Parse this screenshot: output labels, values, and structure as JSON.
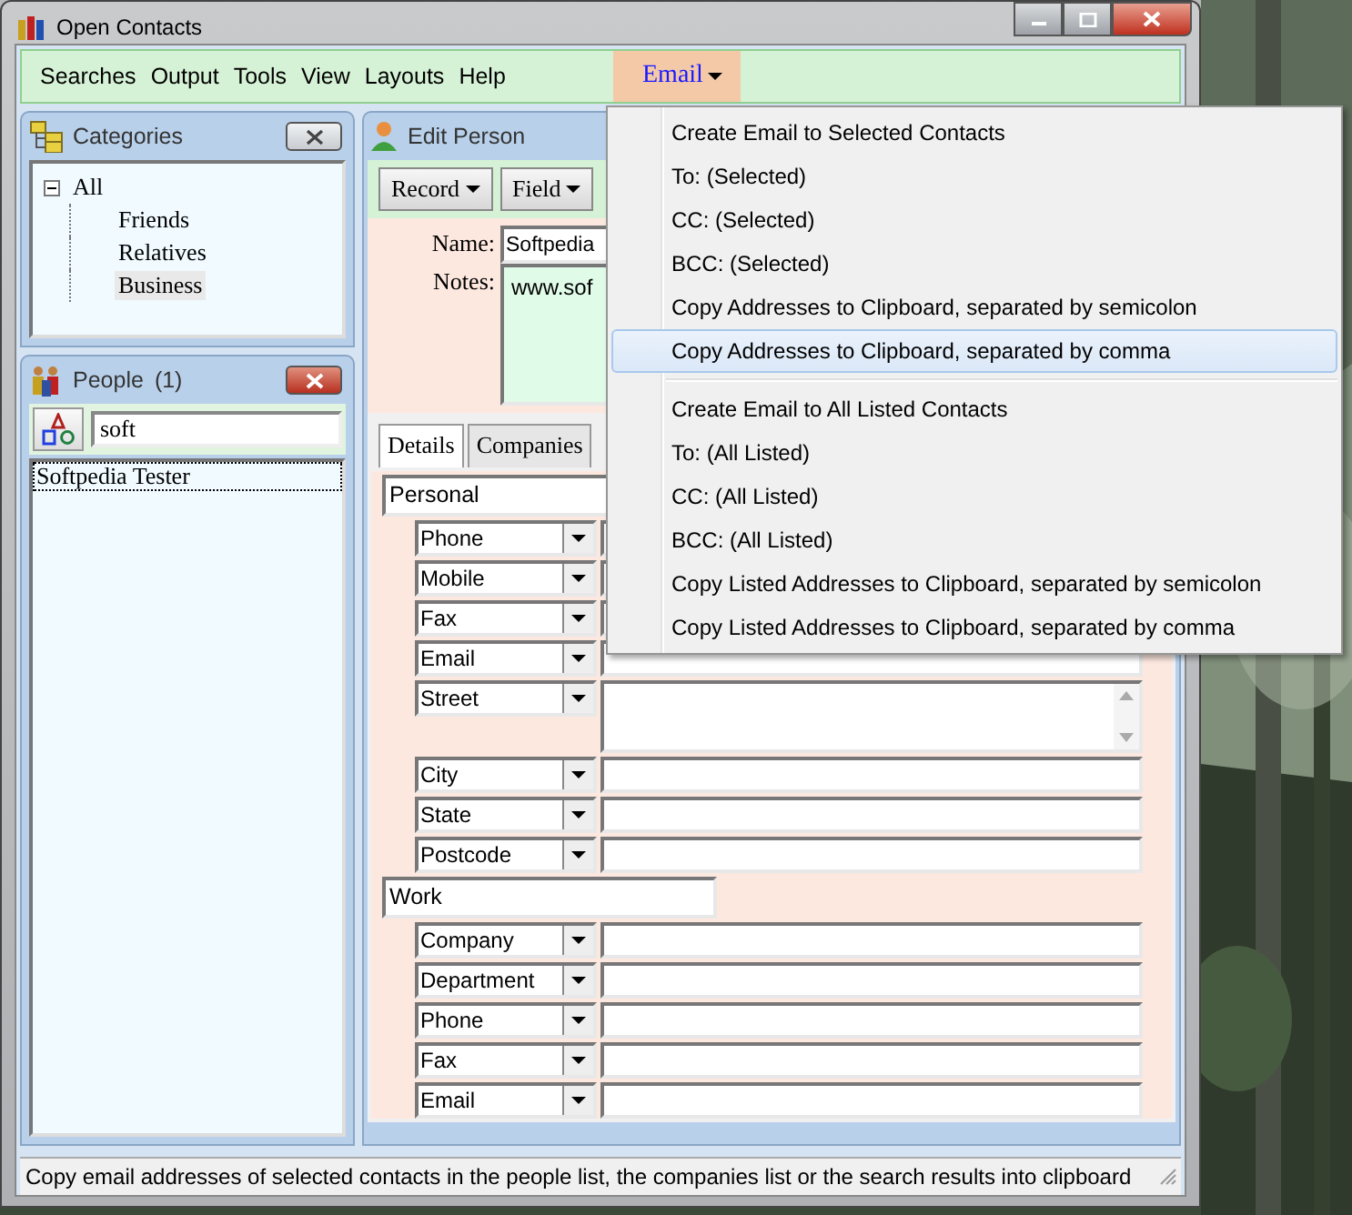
{
  "window": {
    "title": "Open Contacts"
  },
  "menu": [
    {
      "label": "Searches",
      "selected": false
    },
    {
      "label": "Output",
      "selected": false
    },
    {
      "label": "Tools",
      "selected": false
    },
    {
      "label": "View",
      "selected": false
    },
    {
      "label": "Layouts",
      "selected": false
    },
    {
      "label": "Help",
      "selected": false
    },
    {
      "label": "Email",
      "selected": true,
      "kind": "dropdown"
    }
  ],
  "email_menu": [
    [
      {
        "label": "Create Email to Selected Contacts",
        "selected": false
      },
      {
        "label": "To: (Selected)",
        "selected": false
      },
      {
        "label": "CC: (Selected)",
        "selected": false
      },
      {
        "label": "BCC: (Selected)",
        "selected": false
      },
      {
        "label": "Copy Addresses to Clipboard, separated by semicolon",
        "selected": false
      },
      {
        "label": "Copy Addresses to Clipboard, separated by comma",
        "selected": true
      }
    ],
    [
      {
        "label": "Create Email to All Listed Contacts",
        "selected": false
      },
      {
        "label": "To: (All Listed)",
        "selected": false
      },
      {
        "label": "CC: (All Listed)",
        "selected": false
      },
      {
        "label": "BCC: (All Listed)",
        "selected": false
      },
      {
        "label": "Copy Listed Addresses to Clipboard, separated by semicolon",
        "selected": false
      },
      {
        "label": "Copy Listed Addresses to Clipboard, separated by comma",
        "selected": false
      }
    ]
  ],
  "categories": {
    "title": "Categories",
    "tree": {
      "label": "All",
      "expanded": true,
      "children": [
        {
          "label": "Friends",
          "selected": false
        },
        {
          "label": "Relatives",
          "selected": false
        },
        {
          "label": "Business",
          "selected": true
        }
      ]
    }
  },
  "people": {
    "title": "People",
    "count": "(1)",
    "search": "soft",
    "results": [
      {
        "name": "Softpedia Tester",
        "selected": true
      }
    ]
  },
  "edit_person": {
    "title": "Edit Person",
    "toolbar": [
      "Record",
      "Field"
    ],
    "name_label": "Name:",
    "name": "Softpedia",
    "notes_label": "Notes:",
    "notes": "www.sof",
    "tabs": [
      {
        "label": "Details",
        "selected": true
      },
      {
        "label": "Companies",
        "selected": false
      }
    ],
    "groups": [
      {
        "title": "Personal",
        "fields": [
          {
            "label": "Phone",
            "kind": "line"
          },
          {
            "label": "Mobile",
            "kind": "line"
          },
          {
            "label": "Fax",
            "kind": "line"
          },
          {
            "label": "Email",
            "kind": "line"
          },
          {
            "label": "Street",
            "kind": "multiline"
          },
          {
            "label": "City",
            "kind": "line"
          },
          {
            "label": "State",
            "kind": "line"
          },
          {
            "label": "Postcode",
            "kind": "line"
          }
        ]
      },
      {
        "title": "Work",
        "fields": [
          {
            "label": "Company",
            "kind": "line"
          },
          {
            "label": "Department",
            "kind": "line"
          },
          {
            "label": "Phone",
            "kind": "line"
          },
          {
            "label": "Fax",
            "kind": "line"
          },
          {
            "label": "Email",
            "kind": "line"
          }
        ]
      }
    ]
  },
  "status_bar": "Copy email addresses of selected contacts in the people list, the companies list or the search results into clipboard"
}
